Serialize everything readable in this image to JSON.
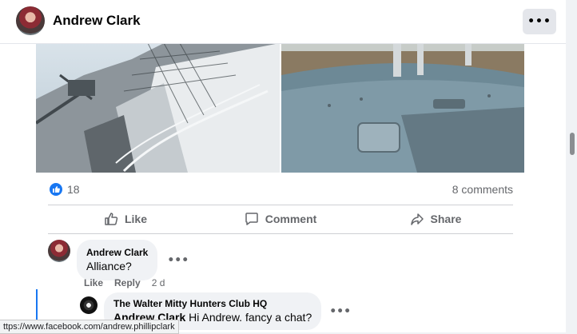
{
  "post": {
    "author_name": "Andrew Clark",
    "more_icon": "more-horizontal-icon",
    "photos": [
      {
        "alt": "Warship superstructure with mast and rigging"
      },
      {
        "alt": "Grey ship deck with gun barrels over water"
      }
    ],
    "reaction_icon": "thumbs-up-icon",
    "reaction_count": "18",
    "comments_count": "8 comments",
    "actions": {
      "like_label": "Like",
      "comment_label": "Comment",
      "share_label": "Share"
    }
  },
  "comments": [
    {
      "author": "Andrew Clark",
      "text": "Alliance?",
      "like_label": "Like",
      "reply_label": "Reply",
      "time": "2 d"
    }
  ],
  "reply": {
    "author": "The Walter Mitty Hunters Club HQ",
    "mention": "Andrew Clark",
    "text": " Hi Andrew. fancy a chat?"
  },
  "status_bar": {
    "url": "ttps://www.facebook.com/andrew.phillipclark"
  },
  "colors": {
    "accent": "#1877f2",
    "muted_text": "#65676b",
    "bubble_bg": "#f0f2f5"
  }
}
